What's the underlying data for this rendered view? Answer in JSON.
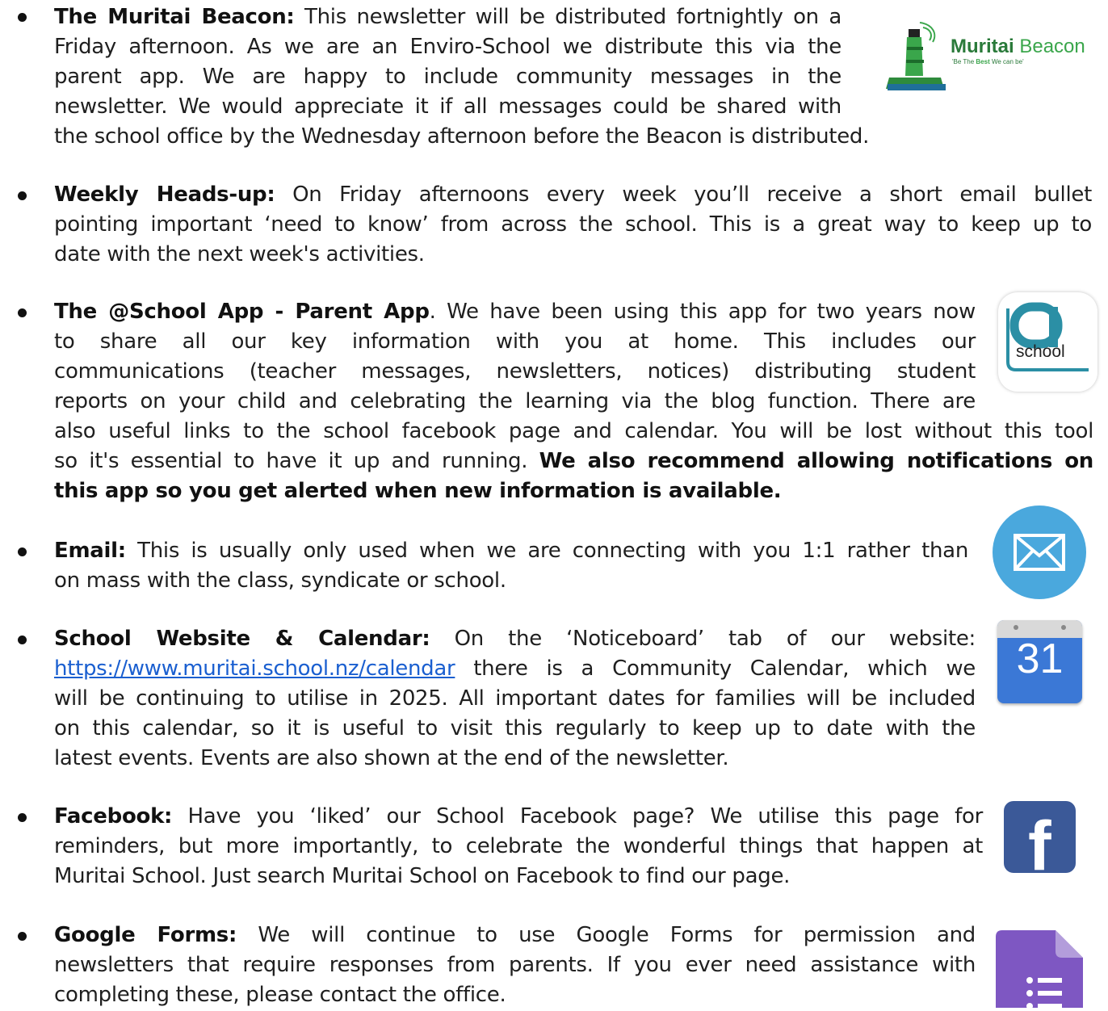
{
  "items": [
    {
      "title": "The Muritai Beacon:",
      "lines": [
        " This newsletter will be distributed fortnightly on a",
        "Friday afternoon. As we are an Enviro-School we distribute this via the",
        "parent app. We are happy to include community messages in the",
        "newsletter. We would appreciate it if all messages could be shared with",
        "the school office by the Wednesday afternoon before the Beacon is distributed."
      ]
    },
    {
      "title": "Weekly Heads-up:",
      "lines": [
        " On Friday afternoons every week you’ll receive a short email bullet",
        "pointing important ‘need to know’ from across the school. This is a great way to keep up to",
        "date with the next week's activities."
      ]
    },
    {
      "title": "The @School App - Parent App",
      "lines": [
        ".  We have been using this app for two years now",
        "to share all our key information with you at home. This includes our",
        "communications (teacher messages, newsletters, notices) distributing student",
        "reports on your child and celebrating the learning via the blog function. There are",
        "also useful links to the school facebook page and calendar. You will be lost without this tool",
        "so it's essential to have it up and running. "
      ],
      "bold_tail_1": "We also recommend allowing notifications on",
      "bold_tail_2": "this app so you get alerted when new information is available."
    },
    {
      "title": "Email:",
      "lines": [
        " This is usually only used when we are connecting with you 1:1 rather than",
        "on mass with the class, syndicate or school."
      ]
    },
    {
      "title": "School Website & Calendar:",
      "lines": [
        " On the ‘Noticeboard’ tab  of our website:",
        "  there is a Community Calendar, which we",
        "will be continuing to utilise in 2025. All important dates for families will be included",
        "on this calendar, so it is useful to visit this regularly to keep up to date with the",
        "latest events.  Events are also shown at the end of the newsletter."
      ],
      "link": "https://www.muritai.school.nz/calendar"
    },
    {
      "title": "Facebook:",
      "lines": [
        " Have you ‘liked’ our School Facebook page? We utilise this page for",
        "reminders, but more importantly, to celebrate the wonderful things that happen at",
        "Muritai School. Just search Muritai School on Facebook to find our page."
      ]
    },
    {
      "title": "Google Forms:",
      "lines": [
        " We will continue to use Google Forms for permission and",
        "newsletters that require responses from parents. If you ever need assistance with",
        "completing these, please contact the office."
      ]
    }
  ],
  "logos": {
    "beacon_name_bold": "Muritai",
    "beacon_name_light": " Beacon",
    "beacon_tag_1": "'Be The ",
    "beacon_tag_best": "Best",
    "beacon_tag_2": " We can be'",
    "school_app_text": "school",
    "calendar_number": "31",
    "facebook_letter": "f"
  },
  "colors": {
    "beacon_green": "#3aa64b",
    "school_teal": "#2b8fa5",
    "email_blue": "#4aa8dd",
    "calendar_blue": "#3b78d6",
    "facebook_blue": "#3b5998",
    "forms_purple": "#7e57c2",
    "link_blue": "#1a5fd0"
  }
}
